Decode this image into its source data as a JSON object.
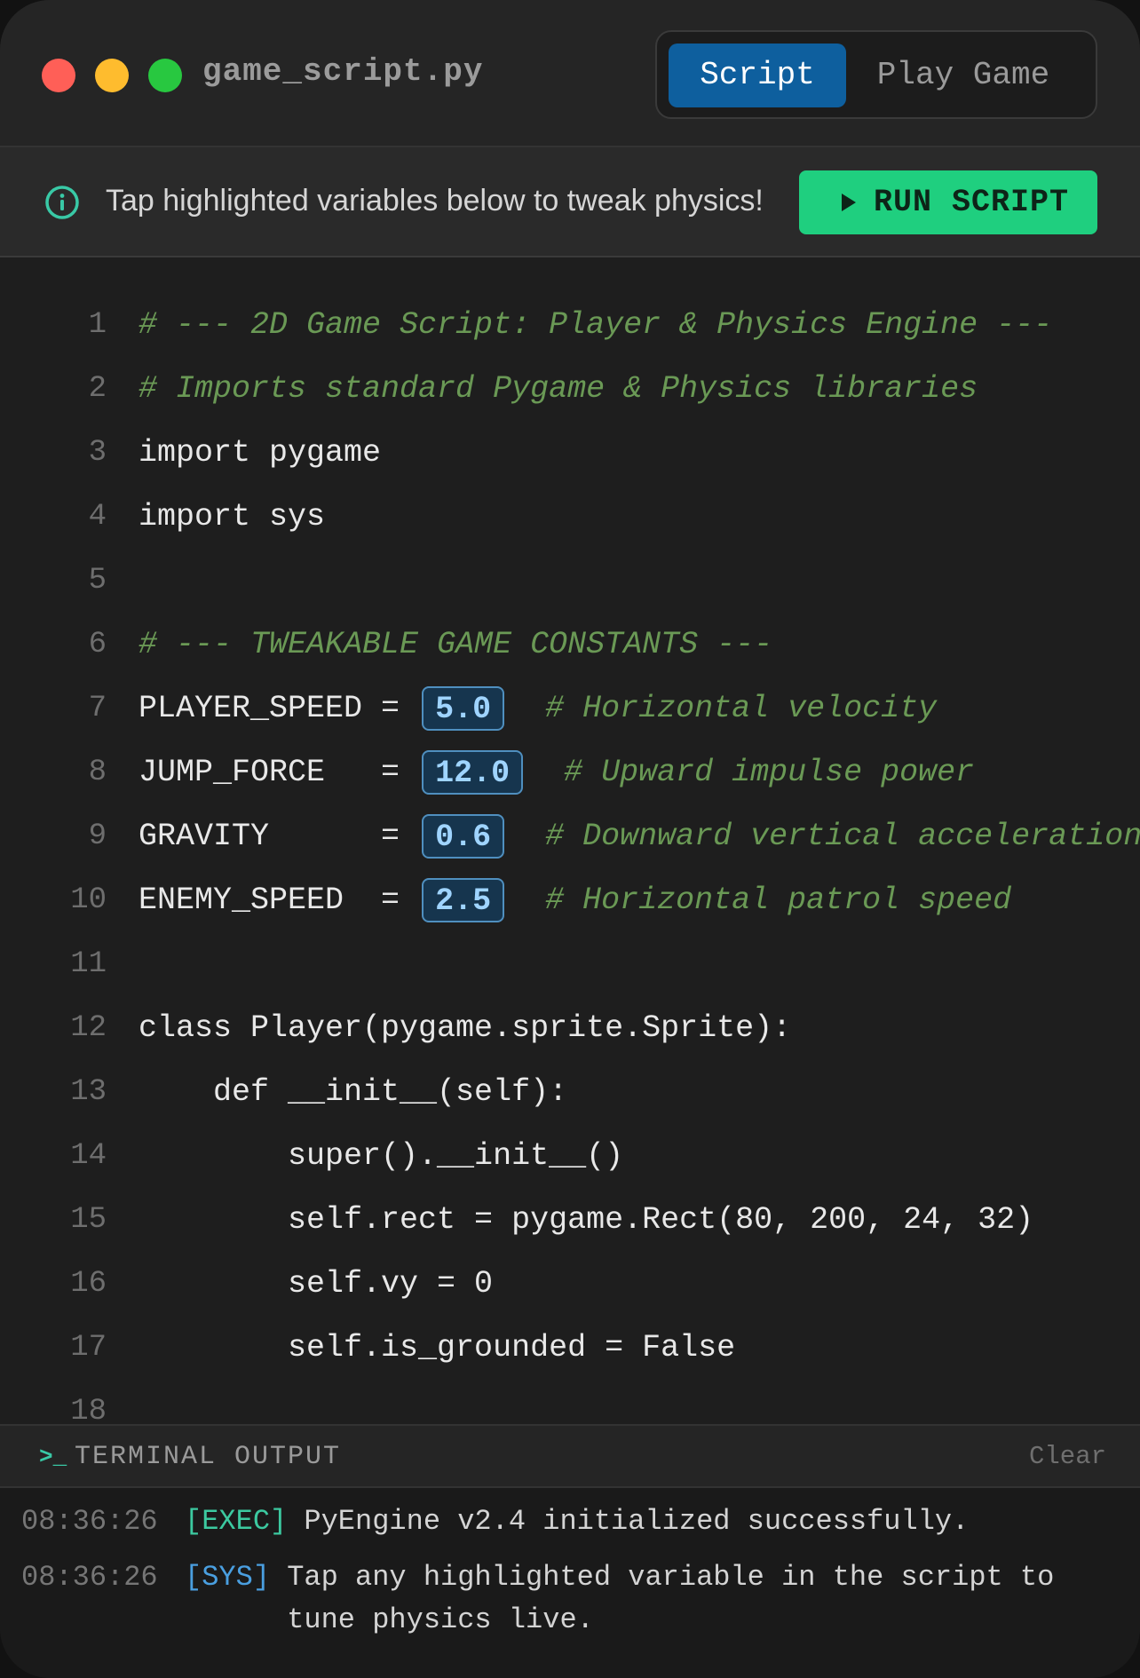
{
  "window": {
    "filename": "game_script.py",
    "tabs": [
      {
        "label": "Script",
        "active": true
      },
      {
        "label": "Play Game",
        "active": false
      }
    ]
  },
  "infobar": {
    "icon": "info-circle-icon",
    "text": "Tap highlighted variables below to tweak physics!",
    "run_button": {
      "icon": "play-icon",
      "label": "RUN SCRIPT"
    }
  },
  "code_lines": [
    {
      "n": "1",
      "comment": "# --- 2D Game Script: Player & Physics Engine ---"
    },
    {
      "n": "2",
      "comment": "# Imports standard Pygame & Physics libraries"
    },
    {
      "n": "3",
      "code": "import pygame"
    },
    {
      "n": "4",
      "code": "import sys"
    },
    {
      "n": "5",
      "code": ""
    },
    {
      "n": "6",
      "comment": "# --- TWEAKABLE GAME CONSTANTS ---"
    },
    {
      "n": "7",
      "name": "PLAYER_SPEED",
      "eq": " = ",
      "value": "5.0",
      "comment": "# Horizontal velocity"
    },
    {
      "n": "8",
      "name": "JUMP_FORCE",
      "eq": "   = ",
      "value": "12.0",
      "comment": "# Upward impulse power"
    },
    {
      "n": "9",
      "name": "GRAVITY",
      "eq": "      = ",
      "value": "0.6",
      "comment": "# Downward vertical acceleration"
    },
    {
      "n": "10",
      "name": "ENEMY_SPEED",
      "eq": "  = ",
      "value": "2.5",
      "comment": "# Horizontal patrol speed"
    },
    {
      "n": "11",
      "code": ""
    },
    {
      "n": "12",
      "code": "class Player(pygame.sprite.Sprite):"
    },
    {
      "n": "13",
      "code": "    def __init__(self):"
    },
    {
      "n": "14",
      "code": "        super().__init__()"
    },
    {
      "n": "15",
      "code": "        self.rect = pygame.Rect(80, 200, 24, 32)"
    },
    {
      "n": "16",
      "code": "        self.vy = 0"
    },
    {
      "n": "17",
      "code": "        self.is_grounded = False"
    },
    {
      "n": "18",
      "code": ""
    }
  ],
  "terminal": {
    "icon": "terminal-prompt-icon",
    "title": "TERMINAL OUTPUT",
    "clear_label": "Clear",
    "logs": [
      {
        "time": "08:36:26",
        "tag": "[EXEC]",
        "tag_color": "#3cc9a0",
        "message": "PyEngine v2.4 initialized successfully."
      },
      {
        "time": "08:36:26",
        "tag": "[SYS]",
        "tag_color": "#4a9fe0",
        "message": "Tap any highlighted variable in the script to tune physics live."
      }
    ]
  },
  "colors": {
    "accent_blue": "#0e5f9e",
    "run_green": "#1fcf7f",
    "comment_green": "#6a9955",
    "variable_highlight": "#9fd4ff"
  }
}
